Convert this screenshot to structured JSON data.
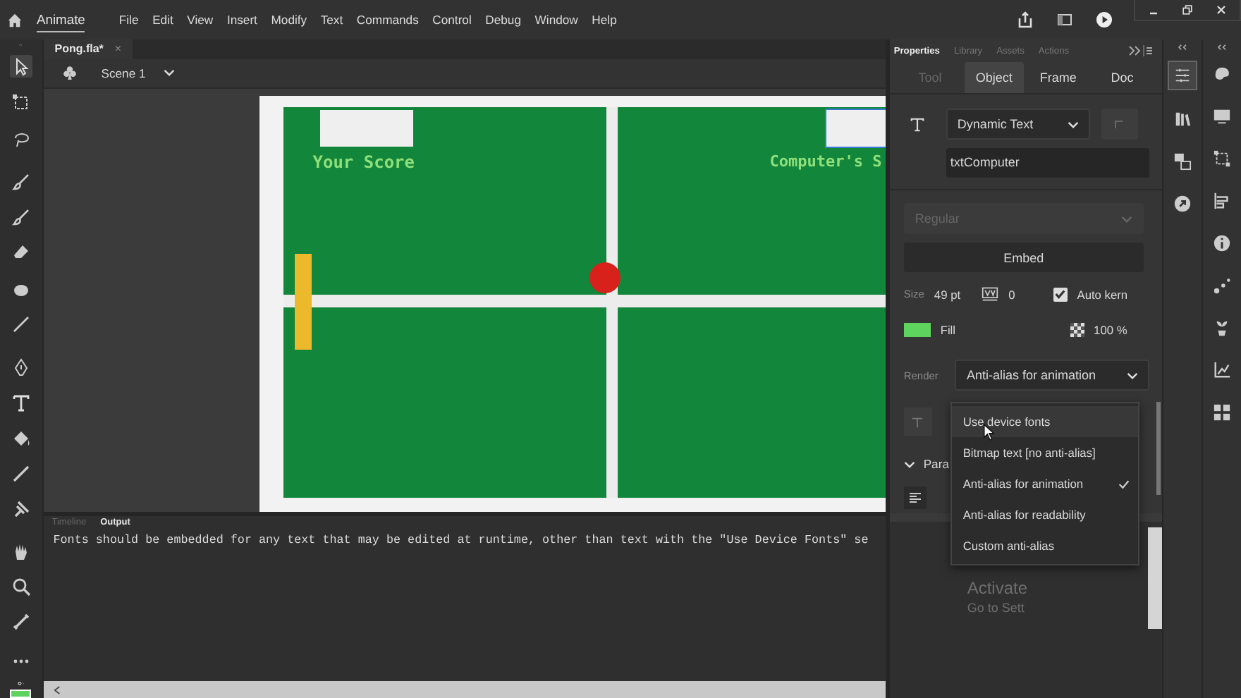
{
  "app": {
    "name": "Animate"
  },
  "menu": [
    "File",
    "Edit",
    "View",
    "Insert",
    "Modify",
    "Text",
    "Commands",
    "Control",
    "Debug",
    "Window",
    "Help"
  ],
  "document_tab": {
    "title": "Pong.fla*",
    "close": "×"
  },
  "scene": {
    "label": "Scene 1"
  },
  "stage": {
    "player_score_label": "Your Score",
    "computer_score_label": "Computer's S"
  },
  "panel_tabs": [
    {
      "label": "Properties",
      "selected": true
    },
    {
      "label": "Library",
      "selected": false
    },
    {
      "label": "Assets",
      "selected": false
    },
    {
      "label": "Actions",
      "selected": false
    }
  ],
  "property_tabs": [
    {
      "label": "Tool",
      "selected": false,
      "disabled": true
    },
    {
      "label": "Object",
      "selected": true,
      "disabled": false
    },
    {
      "label": "Frame",
      "selected": false,
      "disabled": false
    },
    {
      "label": "Doc",
      "selected": false,
      "disabled": false
    }
  ],
  "text_type": "Dynamic Text",
  "instance_name": "txtComputer",
  "font_style": "Regular",
  "embed": "Embed",
  "size": {
    "label": "Size",
    "value": "49 pt"
  },
  "letter_spacing": "0",
  "auto_kern": {
    "label": "Auto kern",
    "checked": true
  },
  "fill": {
    "label": "Fill"
  },
  "alpha": "100 %",
  "render": {
    "label": "Render",
    "value": "Anti-alias for animation"
  },
  "render_menu": [
    {
      "label": "Use device fonts",
      "hovered": true,
      "checked": false
    },
    {
      "label": "Bitmap text [no anti-alias]",
      "hovered": false,
      "checked": false
    },
    {
      "label": "Anti-alias for animation",
      "hovered": false,
      "checked": true
    },
    {
      "label": "Anti-alias for readability",
      "hovered": false,
      "checked": false
    },
    {
      "label": "Custom anti-alias",
      "hovered": false,
      "checked": false
    }
  ],
  "paragraph": {
    "label": "Para"
  },
  "output_tabs": [
    {
      "label": "Timeline",
      "selected": false
    },
    {
      "label": "Output",
      "selected": true
    }
  ],
  "output_text": "Fonts should be embedded for any text that may be edited at runtime, other than text with the \"Use Device Fonts\" se",
  "os_notice": [
    "Activate",
    "Go to Sett"
  ]
}
